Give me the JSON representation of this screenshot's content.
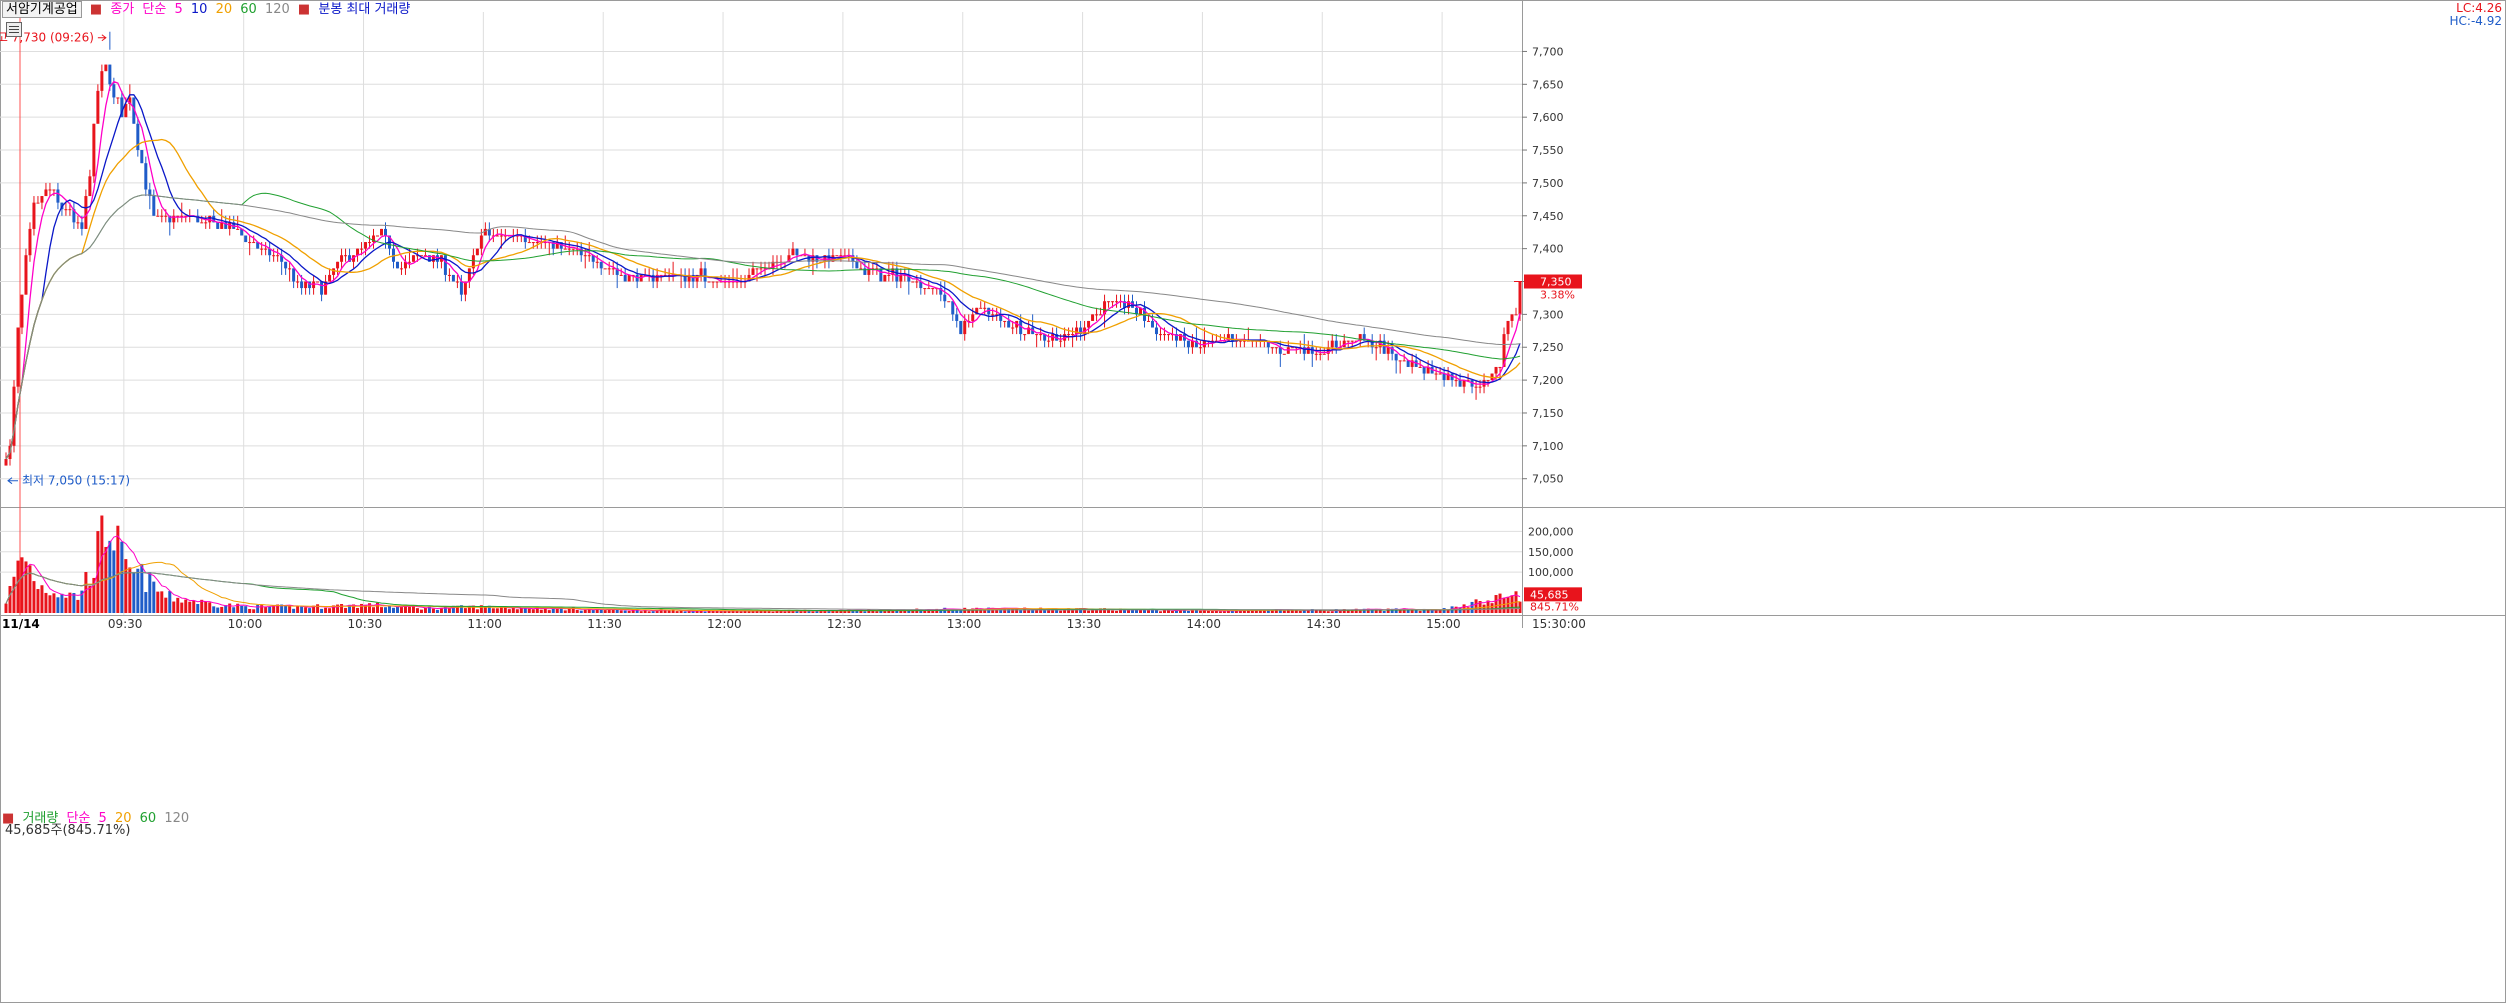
{
  "price_legend": {
    "stock_name": "서암기계공업",
    "close_label": "종가",
    "ma_type": "단순",
    "ma_periods": [
      "5",
      "10",
      "20",
      "60",
      "120"
    ],
    "extra": "분봉 최대 거래량"
  },
  "volume_legend": {
    "title": "거래량",
    "ma_type": "단순",
    "ma_periods": [
      "5",
      "20",
      "60",
      "120"
    ],
    "current": "45,685주(845.71%)"
  },
  "corner": {
    "lc": "LC:4.26",
    "hc": "HC:-4.92"
  },
  "annotations": {
    "high": "최고 7,730 (09:26)",
    "low": "최저 7,050 (15:17)"
  },
  "current_price": {
    "value": "7,350",
    "change": "3.38%"
  },
  "current_volume": {
    "value": "45,685",
    "ratio": "845.71%"
  },
  "date_label": "11/14",
  "end_time": "15:30:00",
  "colors": {
    "up": "#e8141c",
    "down": "#1f5cc8",
    "ma5": "#ff00c8",
    "ma10": "#0a17c8",
    "ma20": "#f0a000",
    "ma60": "#20a030",
    "ma120": "#888888",
    "grid": "#dedede"
  },
  "chart_data": [
    {
      "type": "candlestick",
      "x_axis_ticks": [
        "09:30",
        "10:00",
        "10:30",
        "11:00",
        "11:30",
        "12:00",
        "12:30",
        "13:00",
        "13:30",
        "14:00",
        "14:30",
        "15:00"
      ],
      "y_axis_ticks": [
        "7,700",
        "7,650",
        "7,600",
        "7,550",
        "7,500",
        "7,450",
        "7,400",
        "7,350",
        "7,300",
        "7,250",
        "7,200",
        "7,150",
        "7,100",
        "7,050"
      ],
      "ylim": [
        7010,
        7760
      ],
      "high": 7730,
      "low": 7050,
      "last": 7350,
      "price_path": [
        [
          "09:00",
          7070
        ],
        [
          "09:02",
          7100
        ],
        [
          "09:04",
          7280
        ],
        [
          "09:06",
          7380
        ],
        [
          "09:08",
          7460
        ],
        [
          "09:10",
          7480
        ],
        [
          "09:12",
          7490
        ],
        [
          "09:14",
          7470
        ],
        [
          "09:16",
          7460
        ],
        [
          "09:18",
          7440
        ],
        [
          "09:20",
          7430
        ],
        [
          "09:22",
          7520
        ],
        [
          "09:24",
          7640
        ],
        [
          "09:26",
          7680
        ],
        [
          "09:28",
          7630
        ],
        [
          "09:30",
          7610
        ],
        [
          "09:32",
          7630
        ],
        [
          "09:34",
          7560
        ],
        [
          "09:36",
          7500
        ],
        [
          "09:38",
          7450
        ],
        [
          "09:40",
          7440
        ],
        [
          "09:45",
          7450
        ],
        [
          "09:50",
          7440
        ],
        [
          "09:55",
          7440
        ],
        [
          "10:00",
          7420
        ],
        [
          "10:05",
          7400
        ],
        [
          "10:10",
          7380
        ],
        [
          "10:15",
          7340
        ],
        [
          "10:20",
          7340
        ],
        [
          "10:25",
          7380
        ],
        [
          "10:30",
          7400
        ],
        [
          "10:35",
          7420
        ],
        [
          "10:40",
          7370
        ],
        [
          "10:45",
          7390
        ],
        [
          "10:50",
          7380
        ],
        [
          "10:55",
          7330
        ],
        [
          "11:00",
          7420
        ],
        [
          "11:05",
          7420
        ],
        [
          "11:10",
          7420
        ],
        [
          "11:15",
          7410
        ],
        [
          "11:20",
          7400
        ],
        [
          "11:25",
          7390
        ],
        [
          "11:30",
          7380
        ],
        [
          "11:35",
          7360
        ],
        [
          "11:40",
          7350
        ],
        [
          "11:45",
          7360
        ],
        [
          "11:50",
          7360
        ],
        [
          "11:55",
          7360
        ],
        [
          "12:00",
          7350
        ],
        [
          "12:05",
          7350
        ],
        [
          "12:10",
          7370
        ],
        [
          "12:15",
          7390
        ],
        [
          "12:20",
          7390
        ],
        [
          "12:25",
          7380
        ],
        [
          "12:30",
          7390
        ],
        [
          "12:35",
          7370
        ],
        [
          "12:40",
          7360
        ],
        [
          "12:45",
          7360
        ],
        [
          "12:50",
          7350
        ],
        [
          "12:55",
          7330
        ],
        [
          "13:00",
          7280
        ],
        [
          "13:05",
          7310
        ],
        [
          "13:10",
          7290
        ],
        [
          "13:15",
          7280
        ],
        [
          "13:20",
          7270
        ],
        [
          "13:25",
          7260
        ],
        [
          "13:30",
          7280
        ],
        [
          "13:35",
          7310
        ],
        [
          "13:40",
          7320
        ],
        [
          "13:45",
          7300
        ],
        [
          "13:50",
          7270
        ],
        [
          "13:55",
          7260
        ],
        [
          "14:00",
          7250
        ],
        [
          "14:05",
          7260
        ],
        [
          "14:10",
          7260
        ],
        [
          "14:15",
          7260
        ],
        [
          "14:20",
          7240
        ],
        [
          "14:25",
          7250
        ],
        [
          "14:30",
          7240
        ],
        [
          "14:35",
          7260
        ],
        [
          "14:40",
          7260
        ],
        [
          "14:45",
          7250
        ],
        [
          "14:50",
          7230
        ],
        [
          "14:55",
          7220
        ],
        [
          "15:00",
          7210
        ],
        [
          "15:05",
          7200
        ],
        [
          "15:10",
          7190
        ],
        [
          "15:15",
          7220
        ],
        [
          "15:17",
          7300
        ],
        [
          "15:19",
          7300
        ]
      ]
    },
    {
      "type": "bar",
      "title": "거래량",
      "y_axis_ticks": [
        "200,000",
        "150,000",
        "100,000"
      ],
      "ylim": [
        0,
        240000
      ],
      "volume_samples": [
        [
          "09:00",
          30000
        ],
        [
          "09:02",
          80000
        ],
        [
          "09:04",
          140000
        ],
        [
          "09:06",
          110000
        ],
        [
          "09:08",
          70000
        ],
        [
          "09:10",
          60000
        ],
        [
          "09:14",
          50000
        ],
        [
          "09:18",
          40000
        ],
        [
          "09:22",
          120000
        ],
        [
          "09:24",
          180000
        ],
        [
          "09:26",
          225000
        ],
        [
          "09:30",
          100000
        ],
        [
          "09:34",
          90000
        ],
        [
          "09:40",
          40000
        ],
        [
          "09:50",
          25000
        ],
        [
          "10:00",
          15000
        ],
        [
          "10:15",
          15000
        ],
        [
          "10:30",
          20000
        ],
        [
          "10:45",
          12000
        ],
        [
          "11:00",
          15000
        ],
        [
          "11:30",
          8000
        ],
        [
          "12:00",
          5000
        ],
        [
          "12:30",
          6000
        ],
        [
          "13:00",
          10000
        ],
        [
          "13:30",
          9000
        ],
        [
          "14:00",
          6000
        ],
        [
          "14:30",
          7000
        ],
        [
          "15:00",
          9000
        ],
        [
          "15:19",
          45685
        ]
      ]
    }
  ]
}
